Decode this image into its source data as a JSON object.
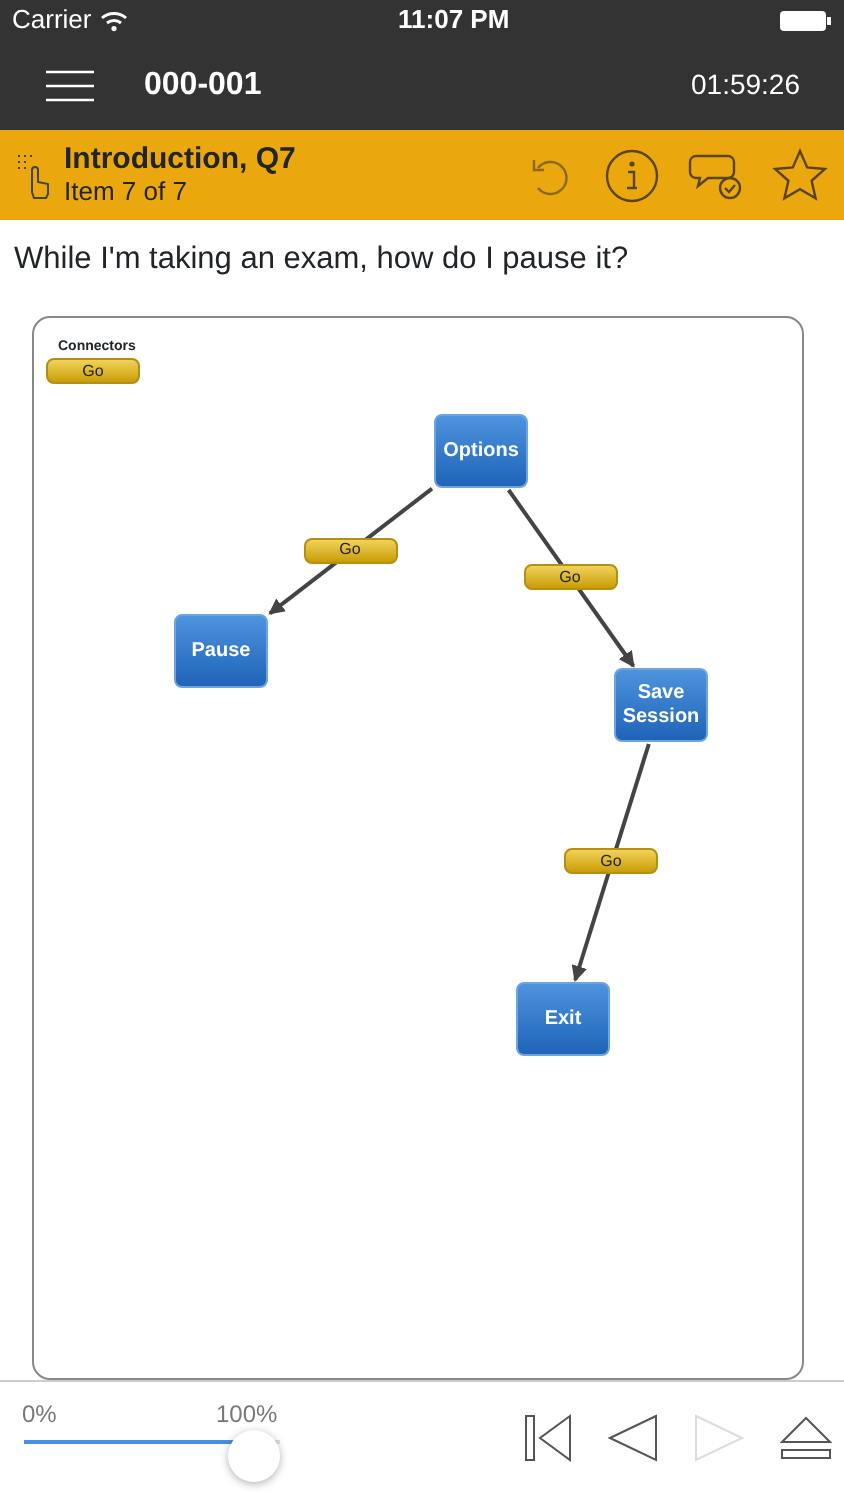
{
  "status_bar": {
    "carrier": "Carrier",
    "time": "11:07 PM"
  },
  "nav_bar": {
    "title": "000-001",
    "timer": "01:59:26"
  },
  "header": {
    "title": "Introduction, Q7",
    "subtitle": "Item 7 of 7",
    "bookmarked": false
  },
  "question": "While I'm taking an exam, how do I pause it?",
  "diagram": {
    "legend_title": "Connectors",
    "legend_label": "Go",
    "nodes": [
      {
        "label": "Options"
      },
      {
        "label": "Pause"
      },
      {
        "label": "Save Session"
      },
      {
        "label": "Exit"
      }
    ],
    "connectors": [
      {
        "label": "Go"
      },
      {
        "label": "Go"
      },
      {
        "label": "Go"
      }
    ]
  },
  "progress": {
    "start_label": "0%",
    "end_label": "100%",
    "level": 0.9
  },
  "toolbar": [
    {
      "kind": "first",
      "disabled": false
    },
    {
      "kind": "previous",
      "disabled": false
    },
    {
      "kind": "next",
      "disabled": true
    },
    {
      "kind": "eject",
      "disabled": false
    }
  ]
}
